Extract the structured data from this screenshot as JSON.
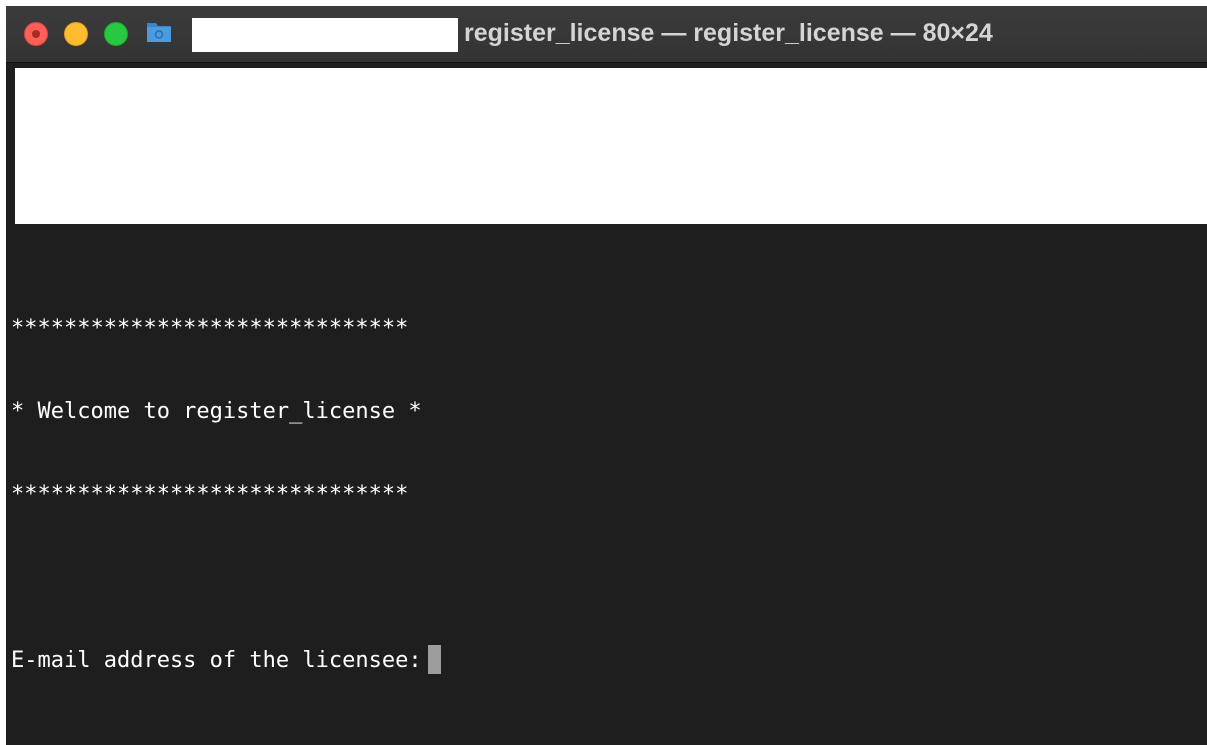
{
  "window": {
    "title": "register_license — register_license — 80×24"
  },
  "icons": {
    "close": "close-button",
    "minimize": "minimize-button",
    "maximize": "zoom-button",
    "folder": "folder-icon"
  },
  "colors": {
    "background": "#1e1e1e",
    "titlebar": "#383838",
    "text": "#ffffff",
    "cursor": "#9d9d9d",
    "traffic_close": "#fe5f57",
    "traffic_minimize": "#febc2e",
    "traffic_maximize": "#28c840"
  },
  "terminal": {
    "lines": [
      "******************************",
      "* Welcome to register_license *",
      "******************************",
      "",
      "E-mail address of the licensee:"
    ],
    "input_value": ""
  }
}
